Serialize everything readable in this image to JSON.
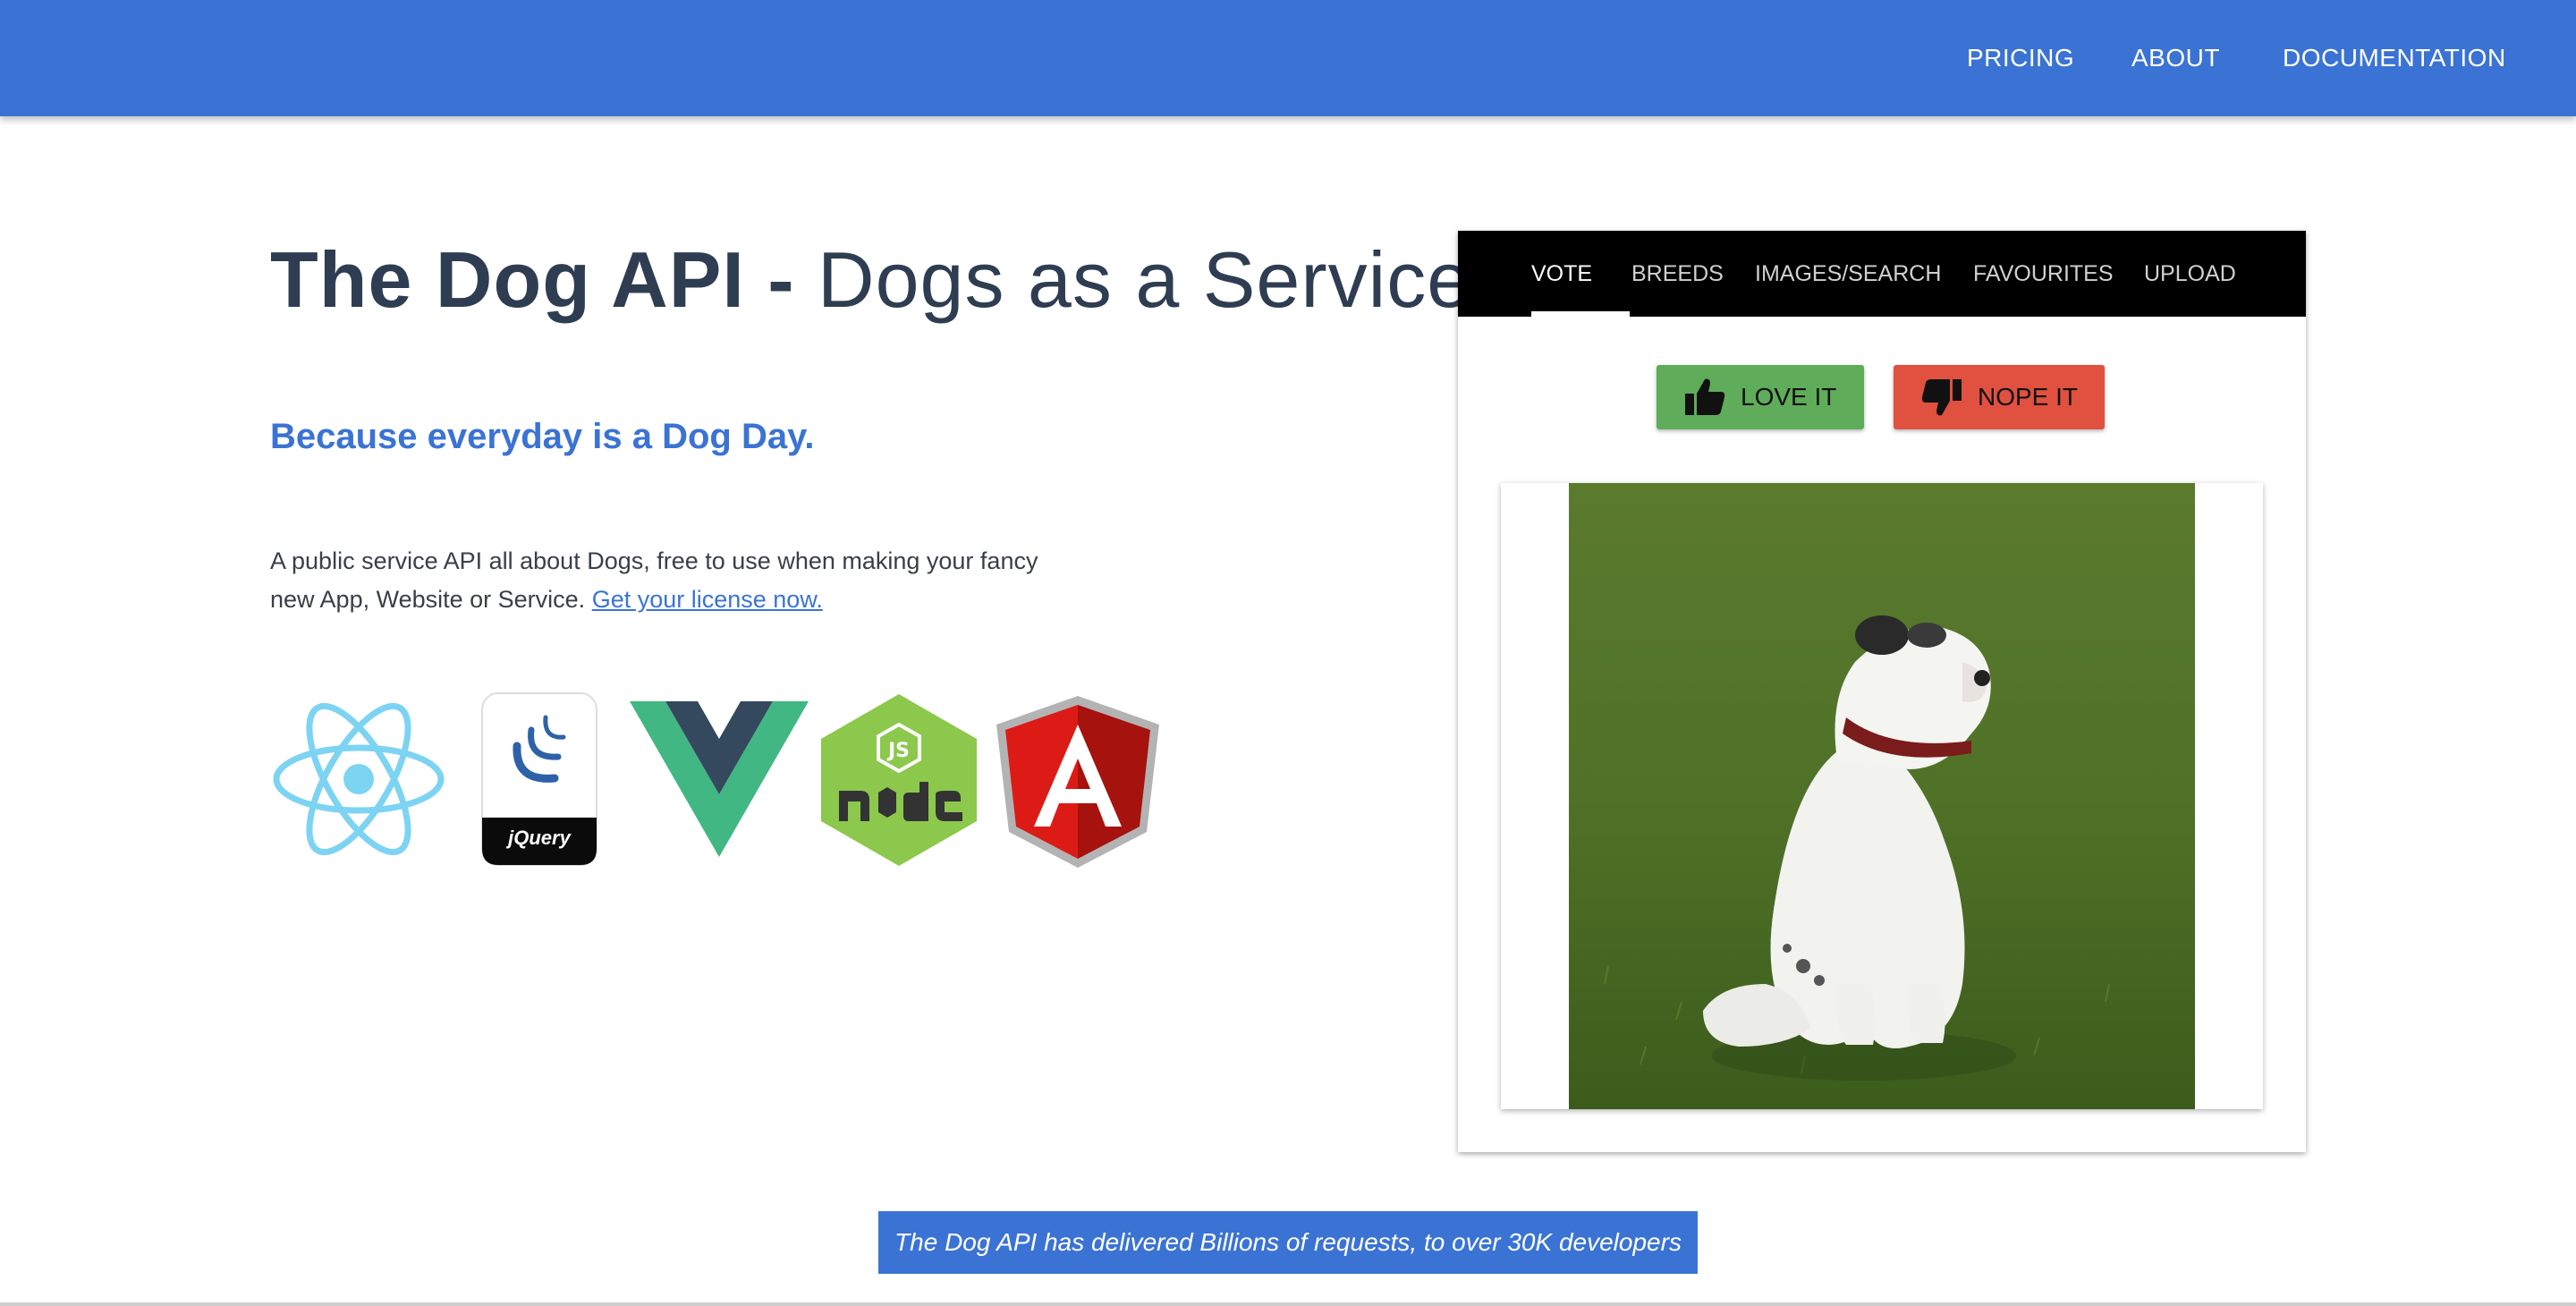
{
  "nav": {
    "items": [
      {
        "label": "PRICING"
      },
      {
        "label": "ABOUT"
      },
      {
        "label": "DOCUMENTATION"
      }
    ]
  },
  "hero": {
    "title_strong": "The Dog API -",
    "title_rest": "Dogs as a Service",
    "tagline": "Because everyday is a Dog Day.",
    "description": "A public service API all about Dogs, free to use when making your fancy new App, Website or Service.",
    "license_link": "Get your license now.",
    "frameworks": [
      "react-logo",
      "jquery-logo",
      "vue-logo",
      "nodejs-logo",
      "angular-logo"
    ],
    "jquery_text": "jQuery"
  },
  "widget": {
    "tabs": [
      {
        "label": "VOTE",
        "active": true
      },
      {
        "label": "BREEDS"
      },
      {
        "label": "IMAGES/SEARCH"
      },
      {
        "label": "FAVOURITES"
      },
      {
        "label": "UPLOAD"
      }
    ],
    "love_label": "LOVE IT",
    "nope_label": "NOPE IT",
    "image": "dog-photo"
  },
  "banner": {
    "text": "The Dog API has delivered Billions of requests, to over 30K developers"
  },
  "colors": {
    "brand_blue": "#3b73d4",
    "love_green": "#5fac5a",
    "nope_red": "#e0513f",
    "title_text": "#2f3d52"
  }
}
